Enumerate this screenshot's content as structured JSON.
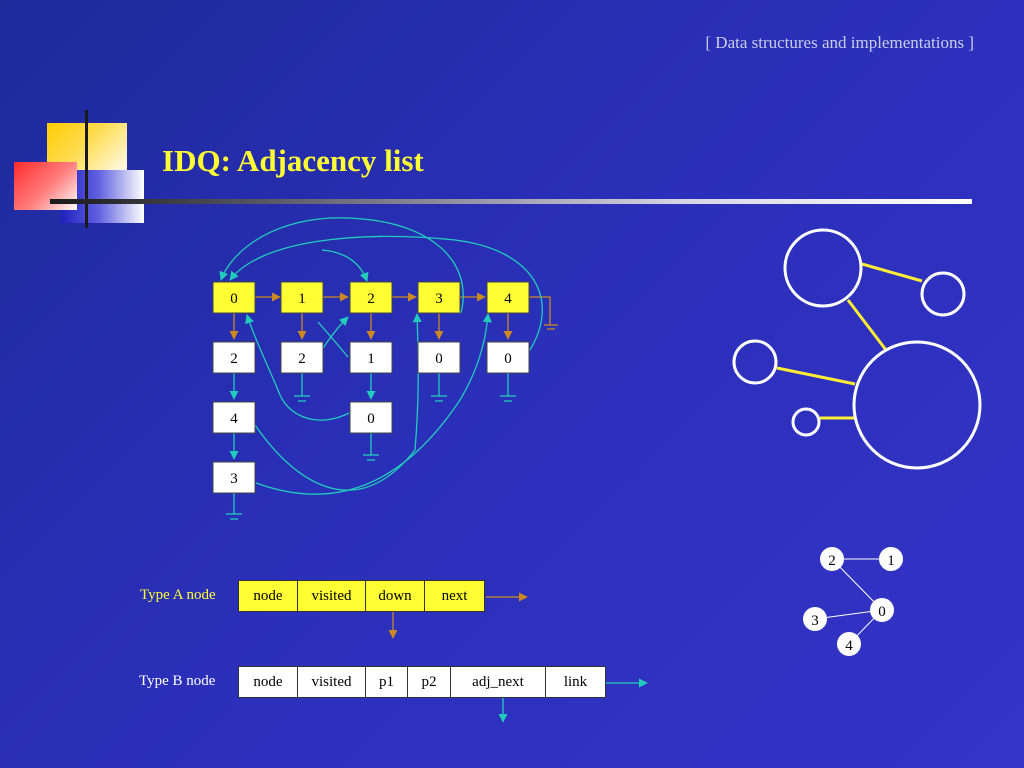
{
  "header": {
    "tag": "[ Data structures and implementations ]"
  },
  "slide": {
    "title": "IDQ: Adjacency list"
  },
  "adjacency": {
    "heads": [
      "0",
      "1",
      "2",
      "3",
      "4"
    ],
    "col0": [
      "2",
      "4",
      "3"
    ],
    "col1": [
      "2"
    ],
    "col2": [
      "1",
      "0"
    ],
    "col3": [
      "0"
    ],
    "col4": [
      "0"
    ]
  },
  "graph": {
    "nodes": [
      "0",
      "1",
      "2",
      "3",
      "4"
    ]
  },
  "type_a": {
    "label": "Type A node",
    "fields": [
      "node",
      "visited",
      "down",
      "next"
    ]
  },
  "type_b": {
    "label": "Type B node",
    "fields": [
      "node",
      "visited",
      "p1",
      "p2",
      "adj_next",
      "link"
    ]
  },
  "colors": {
    "background": "#2a2fb8",
    "title": "#ffff33",
    "head_node": "#ffff33",
    "list_node": "#ffffff",
    "down_arrow": "#cc8822",
    "link_arrow": "#22ccbb",
    "graph_edge_thick": "#ffee33"
  }
}
